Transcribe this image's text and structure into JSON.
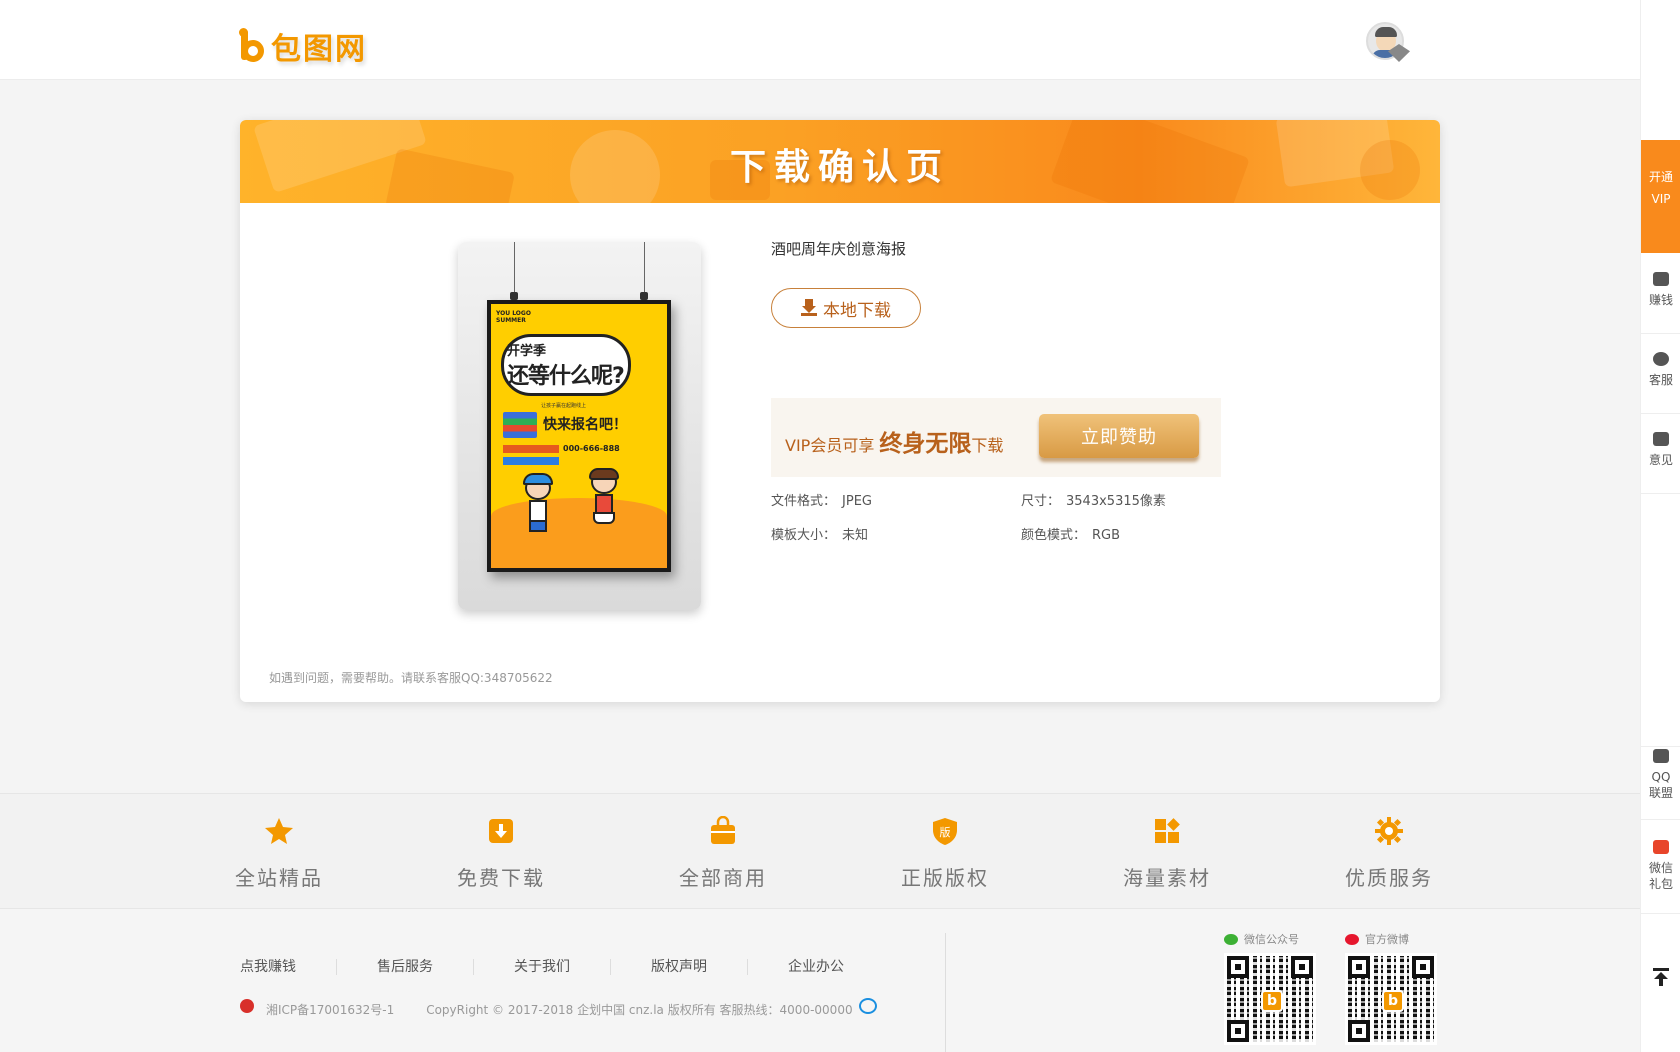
{
  "header": {
    "logo_text": "包图网"
  },
  "banner": {
    "title": "下载确认页"
  },
  "poster": {
    "logo": "YOU LOGO",
    "logo_sub": "SUMMER",
    "headline_1": "开学季",
    "headline_2": "还等什么呢?",
    "sub": "让孩子赢在起跑线上",
    "cta": "快来报名吧！",
    "phone": "000-666-888"
  },
  "resource": {
    "title": "酒吧周年庆创意海报",
    "download_label": "本地下载"
  },
  "vip": {
    "prefix": "VIP会员可享",
    "highlight": "终身无限",
    "suffix": "下载",
    "button_label": "立即赞助"
  },
  "meta": {
    "format_key": "文件格式：",
    "format_value": "JPEG",
    "size_key": "尺寸：",
    "size_value": "3543x5315像素",
    "template_key": "模板大小：",
    "template_value": "未知",
    "color_key": "颜色模式：",
    "color_value": "RGB"
  },
  "help_text": "如遇到问题，需要帮助。请联系客服QQ:348705622",
  "features": [
    {
      "label": "全站精品",
      "icon": "star-icon"
    },
    {
      "label": "免费下载",
      "icon": "download-icon"
    },
    {
      "label": "全部商用",
      "icon": "bag-icon"
    },
    {
      "label": "正版版权",
      "icon": "shield-icon"
    },
    {
      "label": "海量素材",
      "icon": "blocks-icon"
    },
    {
      "label": "优质服务",
      "icon": "gear-icon"
    }
  ],
  "footer": {
    "links": [
      "点我赚钱",
      "售后服务",
      "关于我们",
      "版权声明",
      "企业办公"
    ],
    "icp": "湘ICP备17001632号-1",
    "copyright": "CopyRight © 2017-2018 企划中国 cnz.la 版权所有 客服热线：4000-00000",
    "wechat_label": "微信公众号",
    "weibo_label": "官方微博"
  },
  "sidebar": {
    "vip_line1": "开通",
    "vip_line2": "VIP",
    "items": [
      "赚钱",
      "客服",
      "意见"
    ],
    "qq_line1": "QQ",
    "qq_line2": "联盟",
    "gift_line1": "微信",
    "gift_line2": "礼包"
  },
  "colors": {
    "brand_orange": "#f39800",
    "accent_brown": "#b8611c",
    "vip_gold": "#d89a44"
  }
}
